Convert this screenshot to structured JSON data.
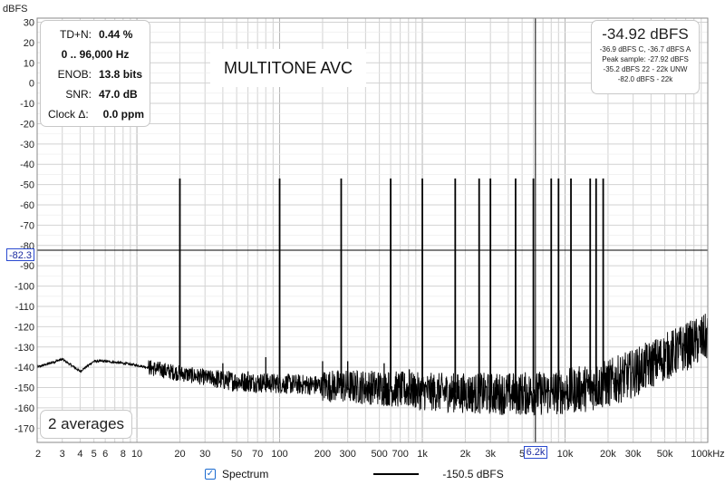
{
  "chart_data": {
    "type": "line",
    "title": "MULTITONE AVC",
    "ylabel": "dBFS",
    "xlabel_unit": "Hz",
    "x_scale": "log",
    "xlim": [
      2,
      100000
    ],
    "ylim": [
      -177,
      32
    ],
    "grid": true,
    "y_ticks": [
      "30",
      "20",
      "10",
      "0",
      "-10",
      "-20",
      "-30",
      "-40",
      "-50",
      "-60",
      "-70",
      "-80",
      "-90",
      "-100",
      "-110",
      "-120",
      "-130",
      "-140",
      "-150",
      "-160",
      "-170"
    ],
    "y_tick_values": [
      30,
      20,
      10,
      0,
      -10,
      -20,
      -30,
      -40,
      -50,
      -60,
      -70,
      -80,
      -90,
      -100,
      -110,
      -120,
      -130,
      -140,
      -150,
      -160,
      -170
    ],
    "x_ticks": [
      {
        "label": "2",
        "value": 2
      },
      {
        "label": "3",
        "value": 3
      },
      {
        "label": "4",
        "value": 4
      },
      {
        "label": "5",
        "value": 5
      },
      {
        "label": "6",
        "value": 6
      },
      {
        "label": "8",
        "value": 8
      },
      {
        "label": "10",
        "value": 10
      },
      {
        "label": "20",
        "value": 20
      },
      {
        "label": "30",
        "value": 30
      },
      {
        "label": "50",
        "value": 50
      },
      {
        "label": "70",
        "value": 70
      },
      {
        "label": "100",
        "value": 100
      },
      {
        "label": "200",
        "value": 200
      },
      {
        "label": "300",
        "value": 300
      },
      {
        "label": "500",
        "value": 500
      },
      {
        "label": "700",
        "value": 700
      },
      {
        "label": "1k",
        "value": 1000
      },
      {
        "label": "2k",
        "value": 2000
      },
      {
        "label": "3k",
        "value": 3000
      },
      {
        "label": "5",
        "value": 5000
      },
      {
        "label": "10k",
        "value": 10000
      },
      {
        "label": "20k",
        "value": 20000
      },
      {
        "label": "30k",
        "value": 30000
      },
      {
        "label": "50k",
        "value": 50000
      },
      {
        "label": "100kHz",
        "value": 100000
      }
    ],
    "tones": [
      {
        "freq": 20,
        "level": -47
      },
      {
        "freq": 100,
        "level": -47
      },
      {
        "freq": 270,
        "level": -47
      },
      {
        "freq": 600,
        "level": -47
      },
      {
        "freq": 1000,
        "level": -47
      },
      {
        "freq": 1700,
        "level": -47
      },
      {
        "freq": 2500,
        "level": -47
      },
      {
        "freq": 3000,
        "level": -47
      },
      {
        "freq": 4500,
        "level": -47
      },
      {
        "freq": 6000,
        "level": -47
      },
      {
        "freq": 8000,
        "level": -47
      },
      {
        "freq": 9000,
        "level": -47
      },
      {
        "freq": 11000,
        "level": -47
      },
      {
        "freq": 15000,
        "level": -47
      },
      {
        "freq": 16500,
        "level": -47
      },
      {
        "freq": 18500,
        "level": -47
      }
    ],
    "harmonics": [
      {
        "freq": 40,
        "level": -138
      },
      {
        "freq": 60,
        "level": -142
      },
      {
        "freq": 80,
        "level": -135
      },
      {
        "freq": 200,
        "level": -137
      },
      {
        "freq": 300,
        "level": -137
      },
      {
        "freq": 540,
        "level": -138
      },
      {
        "freq": 810,
        "level": -141
      }
    ],
    "series": [
      {
        "name": "Spectrum",
        "level_label": "-150.5 dBFS",
        "color": "#000000",
        "floor_points": [
          [
            2,
            -140
          ],
          [
            3,
            -136
          ],
          [
            4,
            -142
          ],
          [
            5,
            -137
          ],
          [
            6,
            -137
          ],
          [
            8,
            -138
          ],
          [
            10,
            -139
          ],
          [
            20,
            -143
          ],
          [
            30,
            -145
          ],
          [
            50,
            -147
          ],
          [
            100,
            -148
          ],
          [
            200,
            -149
          ],
          [
            500,
            -150
          ],
          [
            1000,
            -152
          ],
          [
            3000,
            -153
          ],
          [
            6000,
            -153
          ],
          [
            10000,
            -152
          ],
          [
            15000,
            -150
          ],
          [
            20000,
            -148
          ],
          [
            30000,
            -143
          ],
          [
            50000,
            -135
          ],
          [
            80000,
            -128
          ],
          [
            100000,
            -125
          ]
        ]
      }
    ]
  },
  "cursor": {
    "y_label": "-82.3",
    "y_value": -82.3,
    "x_label": "6.2k",
    "x_value": 6200
  },
  "stats": {
    "thdn_label": "TD+N:",
    "thdn_value": "0.44 %",
    "range": "0 .. 96,000 Hz",
    "enob_label": "ENOB:",
    "enob_value": "13.8 bits",
    "snr_label": "SNR:",
    "snr_value": "47.0 dB",
    "clock_label": "Clock Δ:",
    "clock_value": "0.0 ppm"
  },
  "level_panel": {
    "main": "-34.92 dBFS",
    "line1": "-36.9 dBFS C, -36.7 dBFS A",
    "line2": "Peak sample: -27.92 dBFS",
    "line3": "-35.2 dBFS 22 - 22k UNW",
    "line4": "-82.0 dBFS - 22k"
  },
  "averages": "2 averages",
  "legend": {
    "checkbox": "✓",
    "label": "Spectrum",
    "value": "-150.5 dBFS"
  }
}
